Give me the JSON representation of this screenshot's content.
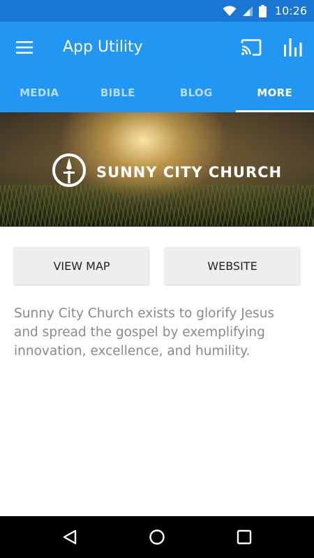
{
  "status_bar": {
    "time": "10:26",
    "icons": [
      "wifi-icon",
      "signal-icon",
      "battery-icon"
    ]
  },
  "app_bar": {
    "title": "App Utility",
    "icons": [
      "menu-icon",
      "cast-icon",
      "bar-chart-icon"
    ],
    "color": "#2196f3"
  },
  "tabs": [
    {
      "label": "MEDIA",
      "active": false
    },
    {
      "label": "BIBLE",
      "active": false
    },
    {
      "label": "BLOG",
      "active": false
    },
    {
      "label": "MORE",
      "active": true
    }
  ],
  "banner": {
    "church_name": "SUNNY CITY CHURCH",
    "logo_icon": "church-compass-logo"
  },
  "buttons": {
    "view_map": "VIEW MAP",
    "website": "WEBSITE"
  },
  "description": "Sunny City Church exists to glorify Jesus and spread the gospel by exemplifying innovation, excellence, and humility.",
  "nav_bar": {
    "icons": [
      "back-icon",
      "home-icon",
      "recents-icon"
    ]
  }
}
